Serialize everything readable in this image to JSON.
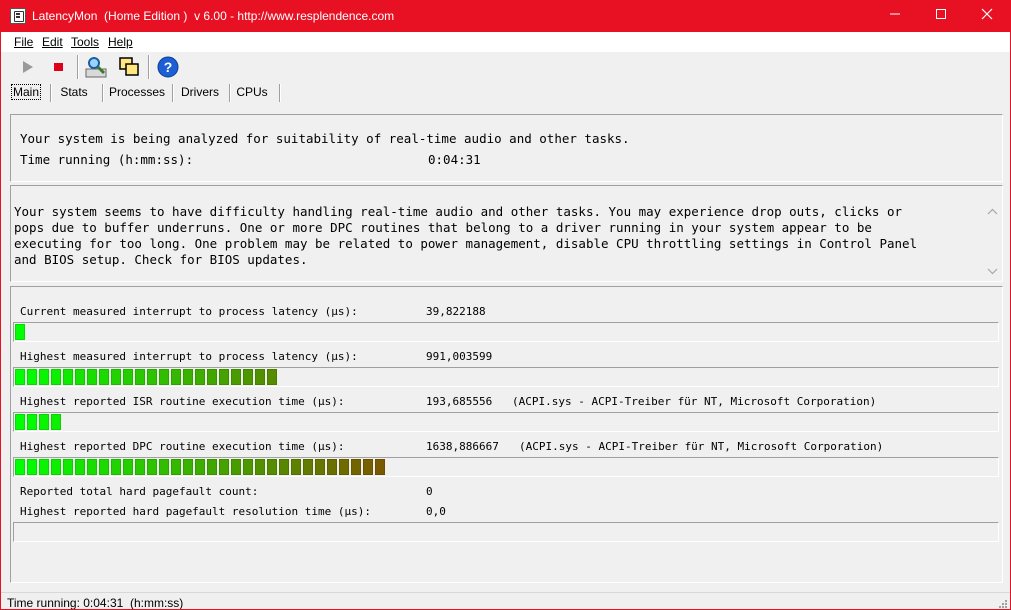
{
  "window": {
    "title": "LatencyMon  (Home Edition )  v 6.00 - http://www.resplendence.com",
    "minimize_glyph": "—",
    "maximize_glyph": "☐",
    "close_glyph": "✕",
    "title_color": "#e81123"
  },
  "menu": {
    "file": "File",
    "edit": "Edit",
    "tools": "Tools",
    "help": "Help"
  },
  "toolbar": {
    "start_icon": "play-icon",
    "stop_icon": "stop-icon",
    "drivers_icon": "magnifier-icon",
    "windows_icon": "windows-icon",
    "help_icon": "help-icon"
  },
  "tabs": [
    {
      "label": "Main"
    },
    {
      "label": "Stats"
    },
    {
      "label": "Processes"
    },
    {
      "label": "Drivers"
    },
    {
      "label": "CPUs"
    }
  ],
  "summary": {
    "line1": "Your system is being analyzed for suitability of real-time audio and other tasks.",
    "time_label": "Time running (h:mm:ss):",
    "time_value": "0:04:31"
  },
  "verdict": {
    "lines": [
      "Your system seems to have difficulty handling real-time audio and other tasks. You may experience drop outs, clicks or",
      "pops due to buffer underruns. One or more DPC routines that belong to a driver running in your system appear to be",
      "executing for too long. One problem may be related to power management, disable CPU throttling settings in Control Panel",
      "and BIOS setup. Check for BIOS updates."
    ]
  },
  "metrics": {
    "current_latency": {
      "label": "Current measured interrupt to process latency (µs):",
      "value": "39,822188",
      "bar_segments": 1
    },
    "highest_latency": {
      "label": "Highest measured interrupt to process latency (µs):",
      "value": "991,003599",
      "bar_segments": 22
    },
    "highest_isr": {
      "label": "Highest reported ISR routine execution time (µs):",
      "value": "193,685556",
      "detail": "(ACPI.sys - ACPI-Treiber für NT, Microsoft Corporation)",
      "bar_segments": 4
    },
    "highest_dpc": {
      "label": "Highest reported DPC routine execution time (µs):",
      "value": "1638,886667",
      "detail": "(ACPI.sys - ACPI-Treiber für NT, Microsoft Corporation)",
      "bar_segments": 31
    },
    "pagefault_count": {
      "label": "Reported total hard pagefault count:",
      "value": "0"
    },
    "pagefault_time": {
      "label": "Highest reported hard pagefault resolution time (µs):",
      "value": "0,0",
      "bar_segments": 0
    }
  },
  "status": {
    "text": "Time running: 0:04:31  (h:mm:ss)"
  },
  "colors": {
    "bar_start": "#00ff00",
    "bar_end": "#7a5a00"
  }
}
